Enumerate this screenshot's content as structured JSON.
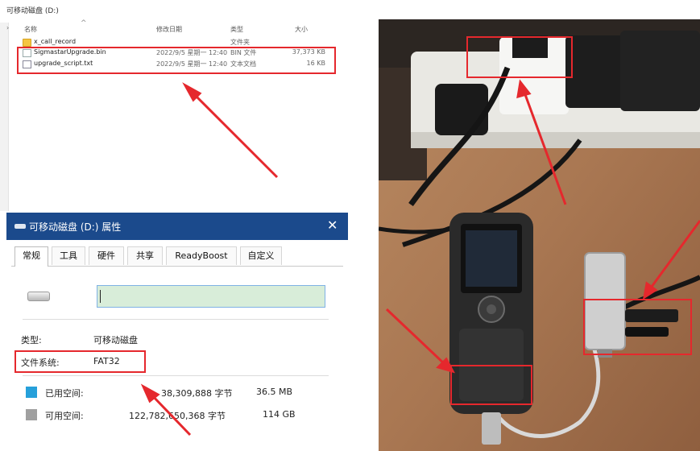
{
  "explorer": {
    "path": "可移动磁盘 (D:)",
    "columns": {
      "name": "名称",
      "date": "修改日期",
      "type": "类型",
      "size": "大小"
    },
    "files": [
      {
        "name": "x_call_record",
        "date": "",
        "type": "文件夹",
        "size": "",
        "icon": "folder-icon"
      },
      {
        "name": "SigmastarUpgrade.bin",
        "date": "2022/9/5 星期一 12:40",
        "type": "BIN 文件",
        "size": "37,373 KB",
        "icon": "file-icon"
      },
      {
        "name": "upgrade_script.txt",
        "date": "2022/9/5 星期一 12:40",
        "type": "文本文档",
        "size": "16 KB",
        "icon": "text-file-icon"
      }
    ]
  },
  "properties": {
    "title": "可移动磁盘 (D:) 属性",
    "close_glyph": "✕",
    "tabs": [
      "常规",
      "工具",
      "硬件",
      "共享",
      "ReadyBoost",
      "自定义"
    ],
    "active_tab": "常规",
    "name_value": "",
    "type_label": "类型:",
    "type_value": "可移动磁盘",
    "fs_label": "文件系统:",
    "fs_value": "FAT32",
    "used": {
      "label": "已用空间:",
      "bytes": "38,309,888 字节",
      "human": "36.5 MB",
      "color": "#26a0da"
    },
    "free": {
      "label": "可用空间:",
      "bytes": "122,782,650,368 字节",
      "human": "114 GB",
      "color": "#a0a0a0"
    }
  },
  "annotations": {
    "color": "#e5282d"
  }
}
